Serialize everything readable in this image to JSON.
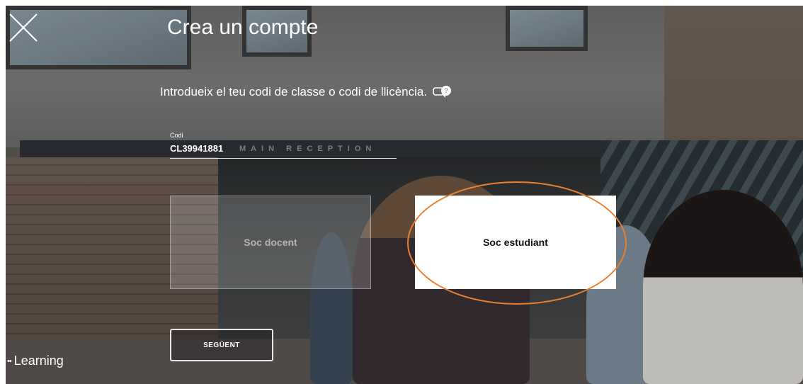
{
  "dialog": {
    "title": "Crea un compte",
    "instruction": "Introdueix el teu codi de classe o codi de llicència.",
    "help_icon": "help-chat-icon",
    "close_icon": "close-icon"
  },
  "code_field": {
    "label": "Codi",
    "value": "CL39941881"
  },
  "roles": {
    "teacher_label": "Soc docent",
    "student_label": "Soc estudiant",
    "selected": "student"
  },
  "next_button": {
    "label": "SEGÜENT"
  },
  "brand": {
    "dots": "••",
    "name": "Learning"
  },
  "background": {
    "sign_text": "MAIN RECEPTION"
  },
  "colors": {
    "highlight": "#e97f2f",
    "card_active": "#ffffff",
    "text_on_dark": "#ffffff"
  }
}
